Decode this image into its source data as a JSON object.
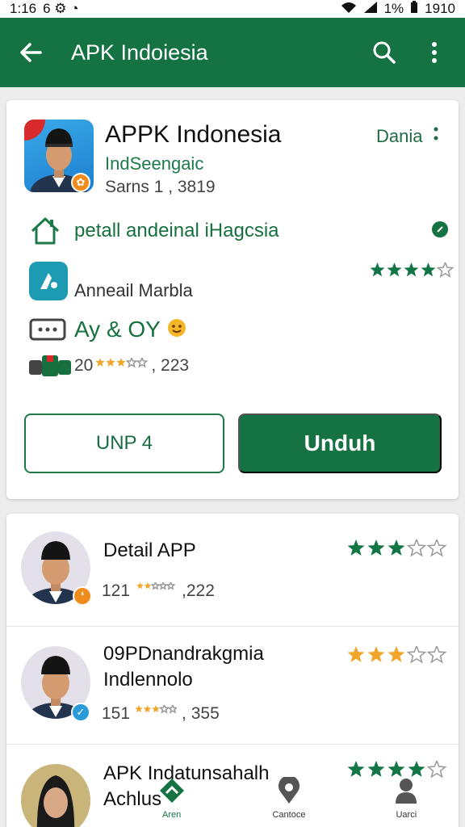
{
  "status_bar": {
    "time": "1:16",
    "left_icons": "6 ⚙ ◔",
    "battery_text": "1%",
    "clock_right": "1910"
  },
  "app_bar": {
    "title": "APK Indoiesia",
    "back_icon": "arrow-left-icon",
    "search_icon": "search-icon",
    "more_icon": "more-vert-icon"
  },
  "app_card": {
    "title": "APPK Indonesia",
    "subtitle": "IndSeengaic",
    "meta": "Sarns 1 , 3819",
    "developer": "Dania",
    "rows": [
      {
        "icon": "home-icon",
        "text": "petall andeinal iHagcsia"
      },
      {
        "icon": "app-tile-icon",
        "text": "Anneail Marbla",
        "rating_fraction": 0.75
      },
      {
        "icon": "keyboard-icon",
        "text": "Ay & OY"
      },
      {
        "icon": "cards-icon",
        "count_left": "20",
        "count_right": ", 223",
        "rating_fraction": 0.6
      }
    ],
    "secondary_button": "UNP 4",
    "primary_button": "Unduh"
  },
  "list": [
    {
      "title": "Detail APP",
      "count_left": "121",
      "count_right": ",222",
      "rating_right": 0.6,
      "rating_meta": 0.4,
      "badge_color": "#f08c1e"
    },
    {
      "title_line1": "09PDnandrakgmia",
      "title_line2": "Indlennolo",
      "count_left": "151",
      "count_right": ", 355",
      "rating_right": 0.6,
      "rating_meta": 0.6,
      "badge_color": "#2a9ad8"
    },
    {
      "title_line1": "APK Indatunsahalh",
      "title_line2": "Achlus",
      "rating_right": 0.8
    }
  ],
  "bottom_nav": [
    {
      "label": "Aren",
      "icon": "diamond-icon",
      "active": true
    },
    {
      "label": "Cantoce",
      "icon": "location-icon",
      "active": false
    },
    {
      "label": "Uarci",
      "icon": "person-icon",
      "active": false
    }
  ],
  "colors": {
    "primary": "#157242",
    "star_gold": "#f2a52b",
    "star_green": "#127546"
  }
}
